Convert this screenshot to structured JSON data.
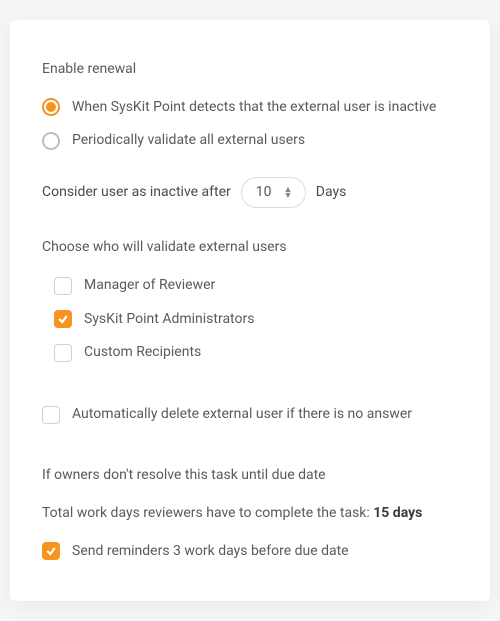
{
  "enableRenewal": {
    "title": "Enable renewal",
    "options": [
      {
        "label": "When SysKit Point detects that the external user is inactive"
      },
      {
        "label": "Periodically validate all external users"
      }
    ]
  },
  "inactiveAfter": {
    "prefix": "Consider user as inactive after",
    "value": "10",
    "suffix": "Days"
  },
  "validators": {
    "title": "Choose who will validate external users",
    "options": [
      {
        "label": "Manager of Reviewer"
      },
      {
        "label": "SysKit Point Administrators"
      },
      {
        "label": "Custom Recipients"
      }
    ]
  },
  "autoDelete": {
    "label": "Automatically delete external user if there is no answer"
  },
  "dueDate": {
    "intro": "If owners don't resolve this task until due date",
    "totalPrefix": "Total work days reviewers have to complete the task: ",
    "totalValue": "15 days",
    "reminderLabel": "Send reminders 3 work days before due date"
  }
}
